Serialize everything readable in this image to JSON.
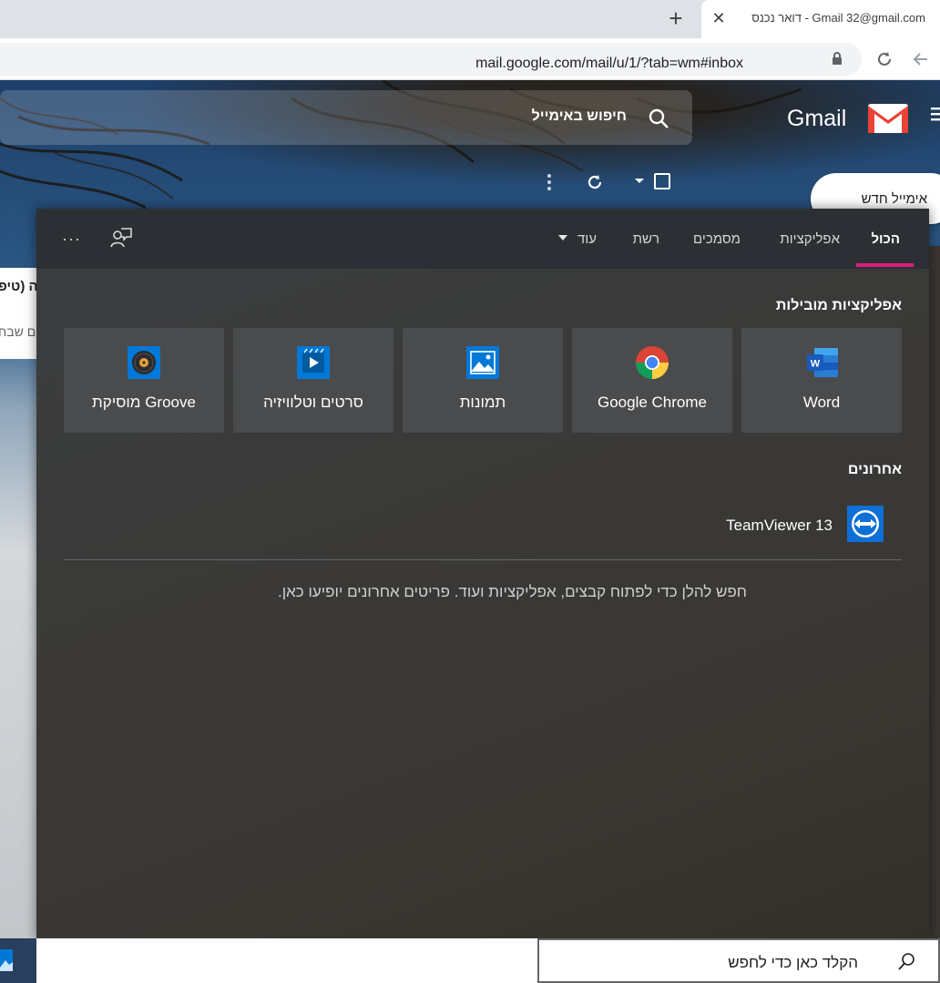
{
  "browser": {
    "tab_title": "דואר נכנס - Gmail ‏32@gmail.com",
    "tab_close": "✕",
    "new_tab": "+",
    "url": "mail.google.com/mail/u/1/?tab=wm#inbox"
  },
  "gmail": {
    "search_placeholder": "חיפוש באימייל",
    "wordmark": "Gmail",
    "compose_label": "אימייל חדש",
    "list_text_1": "ה (טיפ",
    "list_text_2": "ם שבח"
  },
  "flyout": {
    "tabs": [
      {
        "label": "הכול",
        "active": true
      },
      {
        "label": "אפליקציות"
      },
      {
        "label": "מסמכים"
      },
      {
        "label": "רשת"
      },
      {
        "label": "עוד"
      }
    ],
    "overflow": "···",
    "top_apps_title": "אפליקציות מובילות",
    "top_apps": [
      {
        "label": "Word",
        "icon": "word-icon"
      },
      {
        "label": "Google Chrome",
        "icon": "chrome-icon"
      },
      {
        "label": "תמונות",
        "icon": "photos-icon"
      },
      {
        "label": "סרטים וטלוויזיה",
        "icon": "movies-tv-icon"
      },
      {
        "label": "Groove מוסיקת",
        "icon": "groove-music-icon"
      }
    ],
    "recent_title": "אחרונים",
    "recent_items": [
      {
        "label": "TeamViewer 13",
        "icon": "teamviewer-icon"
      }
    ],
    "hint": "חפש להלן כדי לפתוח קבצים, אפליקציות ועוד. פריטים אחרונים יופיעו כאן."
  },
  "taskbar": {
    "search_placeholder": "הקלד כאן כדי לחפש"
  },
  "colors": {
    "accent_underline": "#e01e7a",
    "flyout_bg": "#3a3937",
    "tile_bg": "#4a4b4d"
  }
}
